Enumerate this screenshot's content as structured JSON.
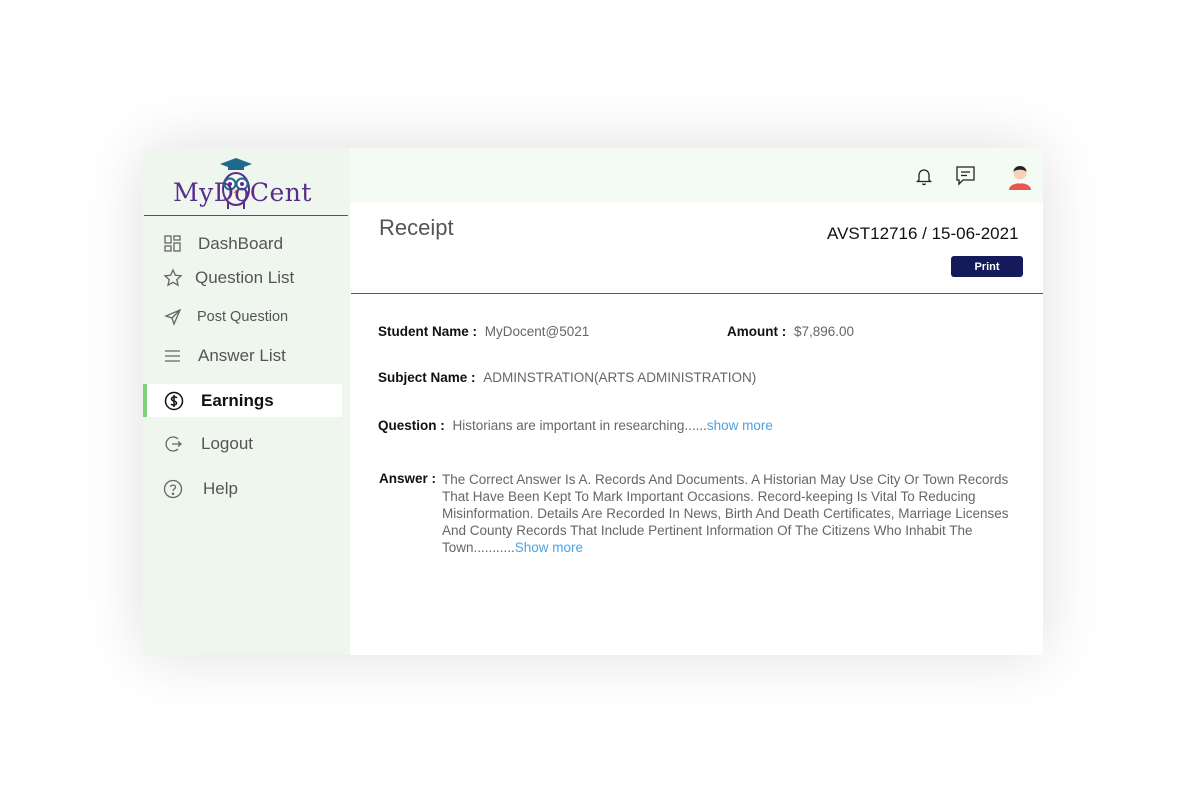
{
  "brand": {
    "logo_text": "MyDoCent"
  },
  "sidebar": {
    "items": [
      {
        "label": "DashBoard",
        "icon": "grid-icon"
      },
      {
        "label": "Question List",
        "icon": "star-icon"
      },
      {
        "label": "Post Question",
        "icon": "send-icon"
      },
      {
        "label": "Answer List",
        "icon": "menu-icon"
      },
      {
        "label": "Earnings",
        "icon": "dollar-icon",
        "active": true
      },
      {
        "label": "Logout",
        "icon": "logout-icon"
      },
      {
        "label": "Help",
        "icon": "help-icon"
      }
    ]
  },
  "topbar": {
    "icons": [
      "bell-icon",
      "chat-icon",
      "avatar"
    ]
  },
  "receipt": {
    "title": "Receipt",
    "id_date": "AVST12716  / 15-06-2021",
    "print_label": "Print",
    "student_name_label": "Student Name :",
    "student_name": "MyDocent@5021",
    "amount_label": "Amount :",
    "amount": "$7,896.00",
    "subject_label": "Subject Name :",
    "subject": "ADMINSTRATION(ARTS ADMINISTRATION)",
    "question_label": "Question :",
    "question": "Historians are important in researching......",
    "question_more": "show more",
    "answer_label": "Answer :",
    "answer": "The Correct Answer Is A. Records And Documents. A Historian May Use City Or Town Records That Have Been Kept To Mark Important Occasions. Record-keeping Is Vital To Reducing Misinformation. Details Are Recorded In News, Birth And Death Certificates, Marriage Licenses And County Records  That Include Pertinent Information Of The Citizens Who Inhabit The Town...........",
    "answer_more": "Show more"
  },
  "colors": {
    "accent": "#7fd07f",
    "button": "#141a5a",
    "link": "#4aa3e8",
    "sidebar_bg": "#eef6ee"
  }
}
